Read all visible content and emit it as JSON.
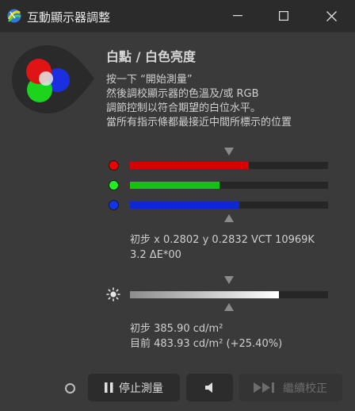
{
  "window": {
    "title": "互動顯示器調整",
    "icons": {
      "app": "app-icon",
      "minimize": "minimize-icon",
      "maximize": "maximize-icon",
      "close": "close-icon"
    }
  },
  "header": {
    "title": "白點 / 白色亮度",
    "instructions": [
      "按一下 “開始測量”",
      "然後調校顯示器的色溫及/或 RGB",
      "調節控制以符合期望的白位水平。",
      "當所有指示條都最接近中間所標示的位置"
    ]
  },
  "rgb_bars": [
    {
      "name": "red",
      "color": "#d90000",
      "dot_color": "#ee0000",
      "level": 0.6
    },
    {
      "name": "green",
      "color": "#12c412",
      "dot_color": "#22ee22",
      "level": 0.45
    },
    {
      "name": "blue",
      "color": "#0a28d8",
      "dot_color": "#1133ee",
      "level": 0.55
    }
  ],
  "rgb_target_level": 0.5,
  "color_readout": {
    "line1": "初步 x 0.2802 y 0.2832 VCT 10969K",
    "line2": "3.2 ΔE*00"
  },
  "brightness": {
    "icon": "brightness-icon",
    "level": 0.75,
    "target_level": 0.5,
    "initial": "初步 385.90 cd/m²",
    "current": "目前 483.93 cd/m² (+25.40%)"
  },
  "footer": {
    "status_icon": "status-circle-icon",
    "stop_label": "停止測量",
    "stop_icon": "pause-icon",
    "sound_icon": "speaker-icon",
    "continue_label": "繼續校正",
    "continue_icon": "skip-forward-icon"
  },
  "colors": {
    "titlebar": "#2b2b2b",
    "background": "#3a3a3a",
    "marker": "#8a8a8a"
  }
}
